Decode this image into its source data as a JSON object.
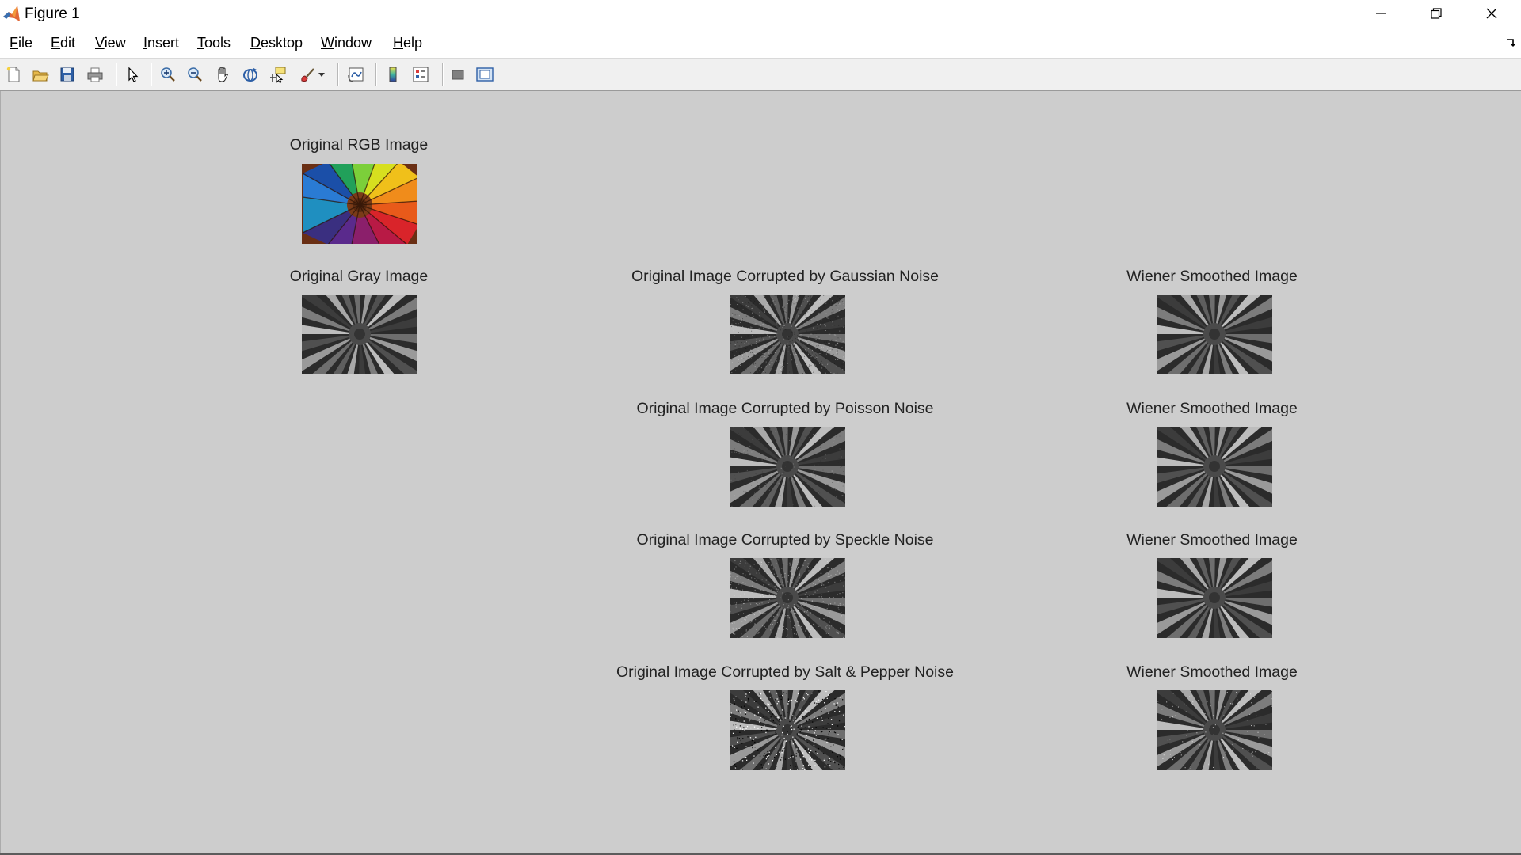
{
  "window": {
    "title": "Figure 1",
    "controls": [
      "minimize",
      "restore",
      "close"
    ]
  },
  "menu": {
    "items": [
      {
        "label": "File",
        "underline": "F"
      },
      {
        "label": "Edit",
        "underline": "E"
      },
      {
        "label": "View",
        "underline": "V"
      },
      {
        "label": "Insert",
        "underline": "I"
      },
      {
        "label": "Tools",
        "underline": "T"
      },
      {
        "label": "Desktop",
        "underline": "D"
      },
      {
        "label": "Window",
        "underline": "W"
      },
      {
        "label": "Help",
        "underline": "H"
      }
    ]
  },
  "toolbar": {
    "buttons": [
      "new-figure-icon",
      "open-file-icon",
      "save-icon",
      "print-icon",
      "edit-plot-icon",
      "zoom-in-icon",
      "zoom-out-icon",
      "pan-icon",
      "rotate-3d-icon",
      "data-cursor-icon",
      "brush-icon",
      "link-plot-icon",
      "insert-colorbar-icon",
      "insert-legend-icon",
      "hide-plot-tools-icon",
      "show-plot-tools-icon"
    ]
  },
  "figure": {
    "subplots": [
      {
        "title": "Original RGB Image",
        "kind": "rgb"
      },
      {
        "title": "Original Gray Image",
        "kind": "gray"
      },
      {
        "title": "Original Image Corrupted by Gaussian Noise",
        "kind": "gaussian"
      },
      {
        "title": "Wiener Smoothed Image",
        "kind": "smooth"
      },
      {
        "title": "Original Image Corrupted by Poisson Noise",
        "kind": "poisson"
      },
      {
        "title": "Wiener Smoothed Image",
        "kind": "smooth"
      },
      {
        "title": "Original Image Corrupted by Speckle Noise",
        "kind": "speckle"
      },
      {
        "title": "Wiener Smoothed Image",
        "kind": "smooth"
      },
      {
        "title": "Original Image Corrupted by Salt & Pepper Noise",
        "kind": "saltpepper"
      },
      {
        "title": "Wiener Smoothed Image",
        "kind": "smooth-sp"
      }
    ]
  },
  "colors": {
    "figure_background": "#cdcdcd",
    "toolbar_background": "#f0f0f0",
    "matlab_orange": "#e16737"
  }
}
